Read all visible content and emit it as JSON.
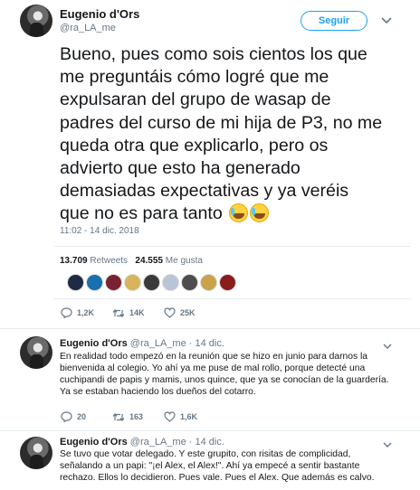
{
  "main_tweet": {
    "author_name": "Eugenio d'Ors",
    "author_handle": "@ra_LA_me",
    "follow_label": "Seguir",
    "text": "Bueno, pues como sois cientos los que\nme preguntáis cómo logré que me\nexpulsaran del grupo de wasap de\npadres del curso de mi hija de P3, no me\nqueda otra que explicarlo, pero os\nadvierto que esto ha generado\ndemasiadas expectativas y ya veréis\nque no es para tanto",
    "emoji_icons": [
      "grinning-sweat-icon",
      "grinning-sweat-icon"
    ],
    "timestamp": "11:02 - 14 dic. 2018",
    "retweets_count": "13.709",
    "retweets_label": "Retweets",
    "likes_count": "24.555",
    "likes_label": "Me gusta",
    "liker_colors": [
      "#1f2a44",
      "#1a6fb0",
      "#7a2230",
      "#d8b45a",
      "#3a3a3a",
      "#b9c4d6",
      "#4d4d4d",
      "#c9a24a",
      "#8b1c1c"
    ],
    "replies": "1,2K",
    "retweets_short": "14K",
    "likes_short": "25K"
  },
  "replies": [
    {
      "author_name": "Eugenio d'Ors",
      "author_handle": "@ra_LA_me",
      "separator": "·",
      "date": "14 dic.",
      "text": "En realidad todo empezó en la reunión que se hizo en junio para darnos la bienvenida al colegio. Yo ahí ya me puse de mal rollo, porque detecté una cuchipandi de papis y mamis, unos quince, que ya se conocían de la guardería. Ya se estaban haciendo los dueños del cotarro.",
      "replies": "20",
      "retweets": "163",
      "likes": "1,6K"
    },
    {
      "author_name": "Eugenio d'Ors",
      "author_handle": "@ra_LA_me",
      "separator": "·",
      "date": "14 dic.",
      "text": "Se tuvo que votar delegado. Y este grupito, con risitas de complicidad, señalando a un papi: \"¡el Alex, el Alex!\". Ahí ya empecé a sentir bastante rechazo. Ellos lo decidieron. Pues vale. Pues el Alex. Que además es calvo.",
      "replies": "",
      "retweets": "",
      "likes": ""
    }
  ],
  "colors": {
    "accent": "#1da1f2",
    "text": "#14171a",
    "secondary": "#657786",
    "divider": "#e6ecf0"
  }
}
